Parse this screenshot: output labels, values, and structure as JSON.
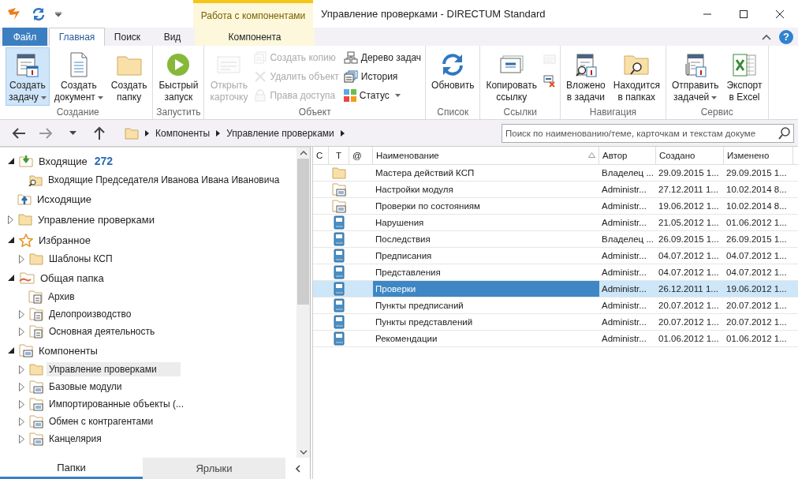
{
  "window": {
    "title": "Управление проверками - DIRECTUM Standard",
    "context_group": "Работа с компонентами"
  },
  "ribbon_tabs": [
    {
      "label": "Файл",
      "kind": "file",
      "selected": false
    },
    {
      "label": "Главная",
      "kind": "normal",
      "selected": true
    },
    {
      "label": "Поиск",
      "kind": "normal",
      "selected": false
    },
    {
      "label": "Вид",
      "kind": "normal",
      "selected": false
    },
    {
      "label": "Компонента",
      "kind": "context",
      "selected": false
    }
  ],
  "help_button": "?",
  "ribbon_groups": [
    {
      "label": "Создание",
      "items": [
        {
          "kind": "large",
          "label": "Создать\nзадачу",
          "dropdown": true,
          "disabled": false,
          "highlighted": true
        },
        {
          "kind": "large",
          "label": "Создать\nдокумент",
          "dropdown": true,
          "disabled": false,
          "highlighted": false
        },
        {
          "kind": "large",
          "label": "Создать\nпапку",
          "dropdown": false,
          "disabled": false,
          "highlighted": false
        }
      ]
    },
    {
      "label": "Запустить",
      "items": [
        {
          "kind": "large",
          "label": "Быстрый\nзапуск",
          "dropdown": false,
          "disabled": false,
          "highlighted": false
        }
      ]
    },
    {
      "label": "Объект",
      "items": [
        {
          "kind": "large",
          "label": "Открыть\nкарточку",
          "dropdown": false,
          "disabled": true,
          "highlighted": false
        },
        {
          "kind": "small",
          "label": "Создать копию",
          "dropdown": false,
          "disabled": true,
          "highlighted": false
        },
        {
          "kind": "small",
          "label": "Удалить объект",
          "dropdown": false,
          "disabled": true,
          "highlighted": false
        },
        {
          "kind": "small",
          "label": "Права доступа",
          "dropdown": false,
          "disabled": true,
          "highlighted": false
        },
        {
          "kind": "small",
          "label": "Дерево задач",
          "dropdown": false,
          "disabled": false,
          "highlighted": false
        },
        {
          "kind": "small",
          "label": "История",
          "dropdown": false,
          "disabled": false,
          "highlighted": false
        },
        {
          "kind": "small",
          "label": "Статус",
          "dropdown": true,
          "disabled": false,
          "highlighted": false
        }
      ]
    },
    {
      "label": "Список",
      "items": [
        {
          "kind": "large",
          "label": "Обновить",
          "dropdown": false,
          "disabled": false,
          "highlighted": false
        }
      ]
    },
    {
      "label": "Ссылки",
      "items": [
        {
          "kind": "large",
          "label": "Копировать\nссылку",
          "dropdown": false,
          "disabled": false,
          "highlighted": false
        },
        {
          "kind": "icon",
          "dropdown": false,
          "disabled": true,
          "highlighted": false
        },
        {
          "kind": "icon",
          "dropdown": false,
          "disabled": false,
          "highlighted": false
        }
      ]
    },
    {
      "label": "Навигация",
      "items": [
        {
          "kind": "large",
          "label": "Вложено\nв задачи",
          "dropdown": false,
          "disabled": false,
          "highlighted": false
        },
        {
          "kind": "large",
          "label": "Находится\nв папках",
          "dropdown": false,
          "disabled": false,
          "highlighted": false
        }
      ]
    },
    {
      "label": "Сервис",
      "items": [
        {
          "kind": "large",
          "label": "Отправить\nзадачей",
          "dropdown": true,
          "disabled": false,
          "highlighted": false
        },
        {
          "kind": "large",
          "label": "Экспорт\nв Excel",
          "dropdown": false,
          "disabled": false,
          "highlighted": false
        }
      ]
    }
  ],
  "breadcrumb": [
    "Компоненты",
    "Управление проверками"
  ],
  "search": {
    "placeholder": "Поиск по наименованию/теме, карточкам и текстам докуме"
  },
  "tree": [
    {
      "label": "Входящие",
      "count": "272",
      "kind": "inbox",
      "expandable": true,
      "expanded": true,
      "selected": false,
      "children": [
        {
          "label": "Входящие Председателя Иванова Ивана Ивановича",
          "kind": "search_folder",
          "expandable": false,
          "selected": false
        }
      ]
    },
    {
      "label": "Исходящие",
      "kind": "outbox",
      "expandable": false,
      "selected": false
    },
    {
      "label": "Управление проверками",
      "kind": "folder",
      "expandable": true,
      "expanded": false,
      "selected": false
    },
    {
      "label": "Избранное",
      "kind": "favorites",
      "expandable": true,
      "expanded": true,
      "selected": false,
      "children": [
        {
          "label": "Шаблоны КСП",
          "kind": "folder",
          "expandable": true,
          "expanded": false,
          "selected": false
        }
      ]
    },
    {
      "label": "Общая папка",
      "kind": "shared_folder",
      "expandable": true,
      "expanded": true,
      "selected": false,
      "children": [
        {
          "label": "Архив",
          "kind": "document_folder",
          "expandable": false,
          "selected": false
        },
        {
          "label": "Делопроизводство",
          "kind": "document_folder",
          "expandable": true,
          "expanded": false,
          "selected": false
        },
        {
          "label": "Основная деятельность",
          "kind": "document_folder",
          "expandable": true,
          "expanded": false,
          "selected": false
        }
      ]
    },
    {
      "label": "Компоненты",
      "kind": "component_folder",
      "expandable": true,
      "expanded": true,
      "selected": false,
      "children": [
        {
          "label": "Управление проверками",
          "kind": "folder",
          "expandable": true,
          "expanded": false,
          "selected": true
        },
        {
          "label": "Базовые модули",
          "kind": "component_folder",
          "expandable": true,
          "expanded": false,
          "selected": false
        },
        {
          "label": "Импортированные объекты (...",
          "kind": "component_folder",
          "expandable": true,
          "expanded": false,
          "selected": false
        },
        {
          "label": "Обмен с контрагентами",
          "kind": "component_folder",
          "expandable": true,
          "expanded": false,
          "selected": false
        },
        {
          "label": "Канцелярия",
          "kind": "component_folder",
          "expandable": true,
          "expanded": false,
          "selected": false
        }
      ]
    }
  ],
  "panel_tabs": [
    {
      "label": "Папки",
      "selected": true
    },
    {
      "label": "Ярлыки",
      "selected": false
    }
  ],
  "table": {
    "columns": [
      {
        "label": "С",
        "sorted_ascending": false
      },
      {
        "label": "Т",
        "sorted_ascending": false
      },
      {
        "label": "@",
        "sorted_ascending": false
      },
      {
        "label": "Наименование",
        "sorted_ascending": true
      },
      {
        "label": "Автор",
        "sorted_ascending": false
      },
      {
        "label": "Создано",
        "sorted_ascending": false
      },
      {
        "label": "Изменено",
        "sorted_ascending": false
      }
    ],
    "rows": [
      {
        "kind": "folder",
        "name": "Мастера действий КСП",
        "author": "Владелец ...",
        "created": "29.09.2015 1...",
        "modified": "29.09.2015 1...",
        "selected": false
      },
      {
        "kind": "component_folder",
        "name": "Настройки модуля",
        "author": "Administr...",
        "created": "27.12.2011 1...",
        "modified": "10.02.2014 8...",
        "selected": false
      },
      {
        "kind": "component_folder",
        "name": "Проверки по состояниям",
        "author": "Administr...",
        "created": "19.06.2012 1...",
        "modified": "10.02.2014 8...",
        "selected": false
      },
      {
        "kind": "reference",
        "name": "Нарушения",
        "author": "Administr...",
        "created": "21.05.2012 1...",
        "modified": "01.06.2012 1...",
        "selected": false
      },
      {
        "kind": "reference",
        "name": "Последствия",
        "author": "Владелец ...",
        "created": "26.09.2015 1...",
        "modified": "26.09.2015 1...",
        "selected": false
      },
      {
        "kind": "reference",
        "name": "Предписания",
        "author": "Administr...",
        "created": "04.07.2012 1...",
        "modified": "04.07.2012 1...",
        "selected": false
      },
      {
        "kind": "reference",
        "name": "Представления",
        "author": "Administr...",
        "created": "04.07.2012 1...",
        "modified": "04.07.2012 1...",
        "selected": false
      },
      {
        "kind": "reference",
        "name": "Проверки",
        "author": "Administr...",
        "created": "26.12.2011 1...",
        "modified": "19.06.2012 1...",
        "selected": true
      },
      {
        "kind": "reference",
        "name": "Пункты предписаний",
        "author": "Administr...",
        "created": "20.07.2012 1...",
        "modified": "20.07.2012 1...",
        "selected": false
      },
      {
        "kind": "reference",
        "name": "Пункты представлений",
        "author": "Administr...",
        "created": "20.07.2012 1...",
        "modified": "20.07.2012 1...",
        "selected": false
      },
      {
        "kind": "reference",
        "name": "Рекомендации",
        "author": "Administr...",
        "created": "01.06.2012 1...",
        "modified": "01.06.2012 1...",
        "selected": false
      }
    ]
  }
}
